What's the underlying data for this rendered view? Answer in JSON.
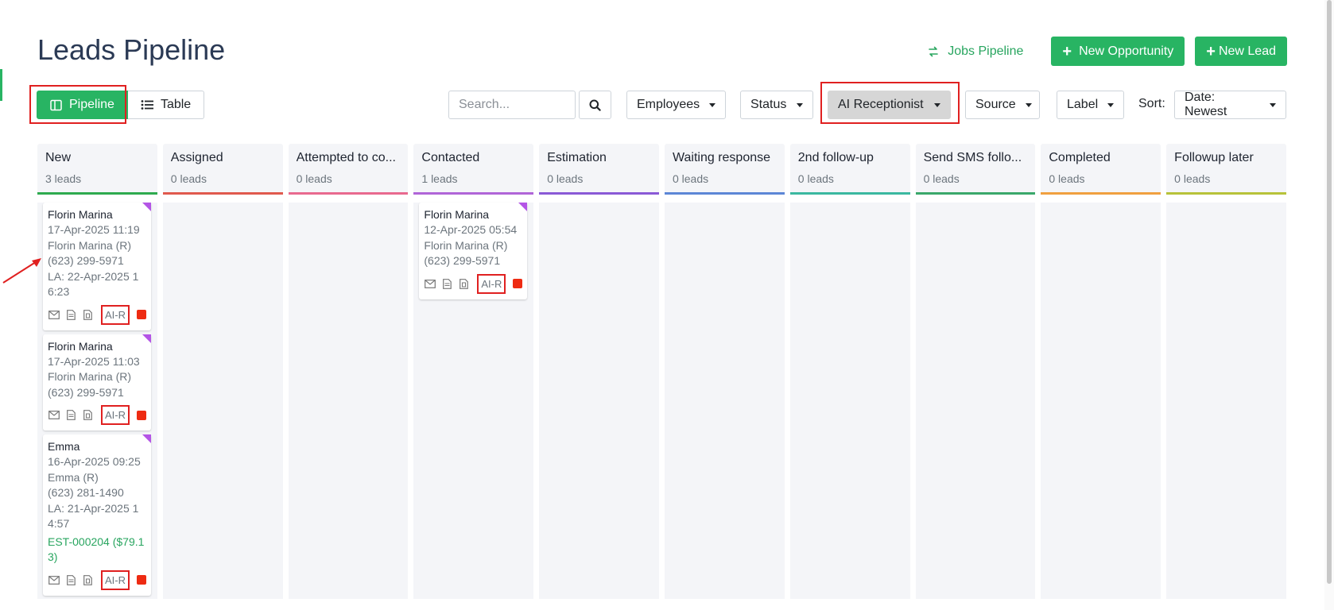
{
  "header": {
    "title": "Leads Pipeline",
    "jobs_link": "Jobs Pipeline",
    "new_opportunity": "New Opportunity",
    "new_lead": "New Lead"
  },
  "toolbar": {
    "pipeline_label": "Pipeline",
    "table_label": "Table",
    "search_placeholder": "Search...",
    "filters": {
      "employees": "Employees",
      "status": "Status",
      "ai_receptionist": "AI Receptionist",
      "source": "Source",
      "label": "Label"
    },
    "sort_label": "Sort:",
    "sort_value": "Date: Newest"
  },
  "columns": [
    {
      "name": "New",
      "count": "3 leads",
      "color": "#2eaa4f"
    },
    {
      "name": "Assigned",
      "count": "0 leads",
      "color": "#e05a4e"
    },
    {
      "name": "Attempted to co...",
      "count": "0 leads",
      "color": "#e8698f"
    },
    {
      "name": "Contacted",
      "count": "1 leads",
      "color": "#b065d8"
    },
    {
      "name": "Estimation",
      "count": "0 leads",
      "color": "#8a5ad6"
    },
    {
      "name": "Waiting response",
      "count": "0 leads",
      "color": "#5c86d6"
    },
    {
      "name": "2nd follow-up",
      "count": "0 leads",
      "color": "#3bb8a0"
    },
    {
      "name": "Send SMS follo...",
      "count": "0 leads",
      "color": "#3aa86a"
    },
    {
      "name": "Completed",
      "count": "0 leads",
      "color": "#f0a040"
    },
    {
      "name": "Followup later",
      "count": "0 leads",
      "color": "#b7c23a"
    }
  ],
  "cards": {
    "new_1": {
      "name": "Florin Marina",
      "date": "17-Apr-2025 11:19",
      "contact": "Florin Marina (R)",
      "phone": "(623) 299-5971",
      "la": "LA: 22-Apr-2025 16:23",
      "tag": "AI-R"
    },
    "new_2": {
      "name": "Florin Marina",
      "date": "17-Apr-2025 11:03",
      "contact": "Florin Marina (R)",
      "phone": "(623) 299-5971",
      "tag": "AI-R"
    },
    "new_3": {
      "name": "Emma",
      "date": "16-Apr-2025 09:25",
      "contact": "Emma (R)",
      "phone": "(623) 281-1490",
      "la": "LA: 21-Apr-2025 14:57",
      "estimate": "EST-000204 ($79.13)",
      "tag": "AI-R"
    },
    "contacted_1": {
      "name": "Florin Marina",
      "date": "12-Apr-2025 05:54",
      "contact": "Florin Marina (R)",
      "phone": "(623) 299-5971",
      "tag": "AI-R"
    }
  },
  "icons": {
    "swap": "arrows-swap-icon",
    "plus": "plus-icon",
    "columns": "columns-icon",
    "list": "list-icon",
    "search": "search-icon",
    "mail": "mail-icon",
    "document": "document-icon",
    "file": "file-icon"
  }
}
